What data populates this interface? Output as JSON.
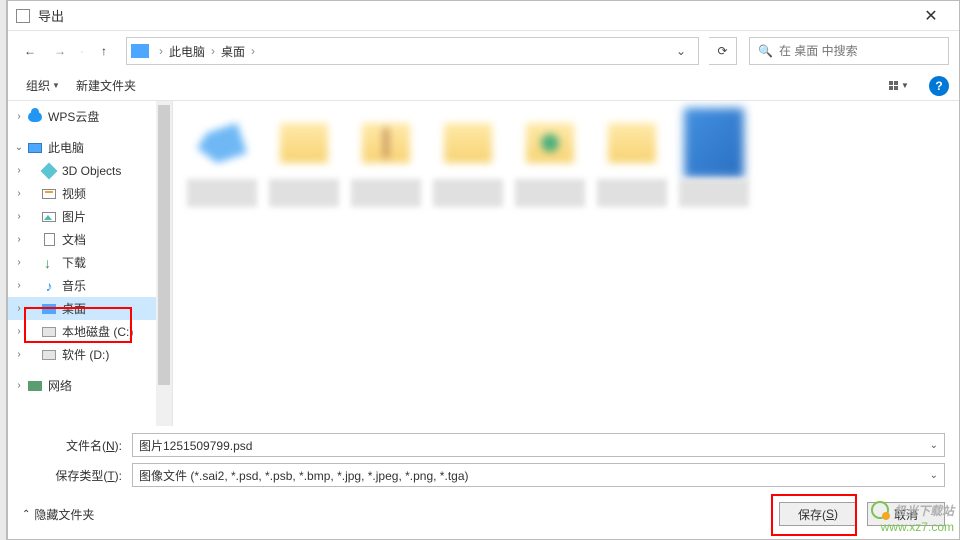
{
  "window": {
    "title": "导出"
  },
  "nav": {
    "back": "←",
    "forward": "→",
    "up": "↑"
  },
  "address": {
    "crumbs": [
      "此电脑",
      "桌面"
    ],
    "separator": "›"
  },
  "search": {
    "placeholder": "在 桌面 中搜索"
  },
  "menubar": {
    "organize": "组织",
    "new_folder": "新建文件夹"
  },
  "sidebar": {
    "items": [
      {
        "label": "WPS云盘",
        "icon": "cloud",
        "indent": 0,
        "caret": ">"
      },
      {
        "label": "此电脑",
        "icon": "monitor",
        "indent": 0,
        "caret": "v"
      },
      {
        "label": "3D Objects",
        "icon": "cube",
        "indent": 1,
        "caret": ">"
      },
      {
        "label": "视频",
        "icon": "video",
        "indent": 1,
        "caret": ">"
      },
      {
        "label": "图片",
        "icon": "pic",
        "indent": 1,
        "caret": ">"
      },
      {
        "label": "文档",
        "icon": "doc",
        "indent": 1,
        "caret": ">"
      },
      {
        "label": "下载",
        "icon": "down",
        "indent": 1,
        "caret": ">"
      },
      {
        "label": "音乐",
        "icon": "music",
        "indent": 1,
        "caret": ">"
      },
      {
        "label": "桌面",
        "icon": "desktop",
        "indent": 1,
        "caret": ">",
        "selected": true
      },
      {
        "label": "本地磁盘 (C:)",
        "icon": "disk",
        "indent": 1,
        "caret": ">"
      },
      {
        "label": "软件 (D:)",
        "icon": "disk",
        "indent": 1,
        "caret": ">"
      },
      {
        "label": "网络",
        "icon": "network",
        "indent": 0,
        "caret": ">"
      }
    ]
  },
  "form": {
    "filename_label_pre": "文件名(",
    "filename_label_accel": "N",
    "filename_label_post": "):",
    "filename_value": "图片1251509799.psd",
    "filetype_label_pre": "保存类型(",
    "filetype_label_accel": "T",
    "filetype_label_post": "):",
    "filetype_value": "图像文件 (*.sai2, *.psd, *.psb, *.bmp, *.jpg, *.jpeg, *.png, *.tga)"
  },
  "footer": {
    "hide_folders": "隐藏文件夹",
    "save_pre": "保存(",
    "save_accel": "S",
    "save_post": ")",
    "cancel": "取消"
  },
  "watermark": {
    "brand": "极光下载站",
    "url": "www.xz7.com"
  }
}
